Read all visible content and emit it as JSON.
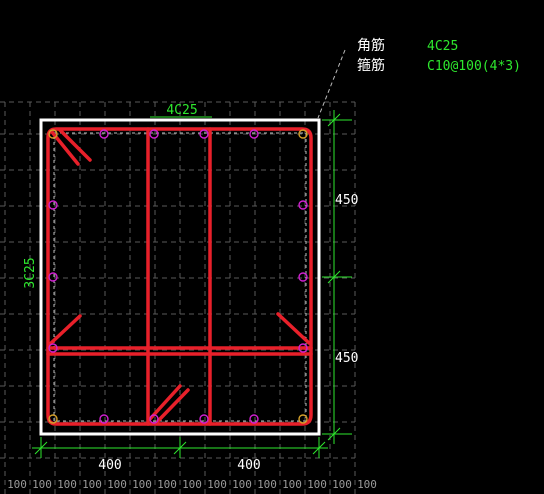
{
  "legend": {
    "corner_label": "角筋",
    "corner_value": "4C25",
    "stirrup_label": "箍筋",
    "stirrup_value": "C10@100(4*3)"
  },
  "annotations": {
    "top_bars": "4C25",
    "side_bars": "3C25"
  },
  "dimensions": {
    "right_upper": "450",
    "right_lower": "450",
    "bottom_left": "400",
    "bottom_right": "400"
  },
  "grid_scale": [
    "100",
    "100",
    "100",
    "100",
    "100",
    "100",
    "100",
    "100",
    "100",
    "100",
    "100",
    "100",
    "100",
    "100",
    "100"
  ],
  "colors": {
    "background": "#000000",
    "section_outline": "#ffffff",
    "stirrup": "#e8202a",
    "dimension": "#2ee82e",
    "bar_marker": "#d020d0",
    "corner_marker": "#d4a02a",
    "grid": "#5a5a5a",
    "text": "#ffffff"
  }
}
